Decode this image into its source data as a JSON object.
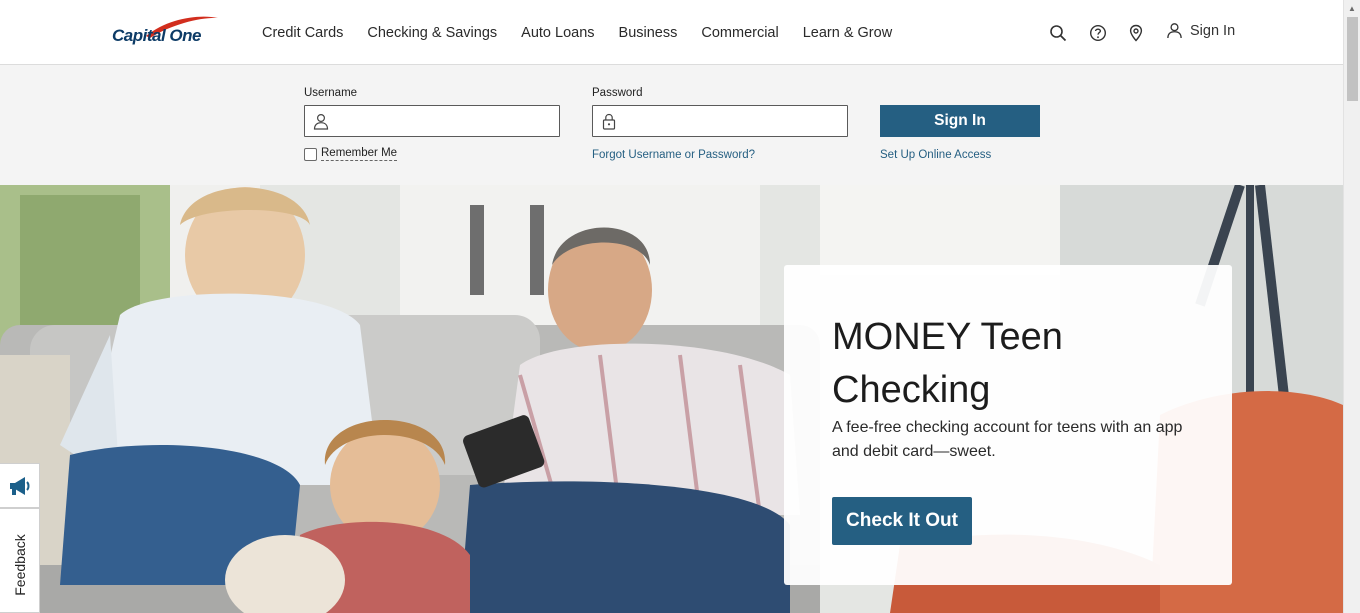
{
  "brand": {
    "logo_text": "Capital One",
    "primary_color": "#255f82",
    "logo_blue": "#0d3b66",
    "logo_red": "#d22e1e"
  },
  "nav": {
    "items": [
      "Credit Cards",
      "Checking & Savings",
      "Auto Loans",
      "Business",
      "Commercial",
      "Learn & Grow"
    ],
    "utility_icons": [
      "search-icon",
      "help-icon",
      "location-pin-icon",
      "user-icon"
    ],
    "sign_in": "Sign In"
  },
  "login": {
    "username_label": "Username",
    "username_value": "",
    "password_label": "Password",
    "password_value": "",
    "sign_in_button": "Sign In",
    "remember_me": "Remember Me",
    "remember_checked": false,
    "forgot_link": "Forgot Username or Password?",
    "setup_link": "Set Up Online Access"
  },
  "hero": {
    "title": "MONEY Teen Checking",
    "description": "A fee-free checking account for teens with an app and debit card—sweet.",
    "cta": "Check It Out"
  },
  "feedback": {
    "label": "Feedback",
    "icon": "megaphone-icon"
  }
}
